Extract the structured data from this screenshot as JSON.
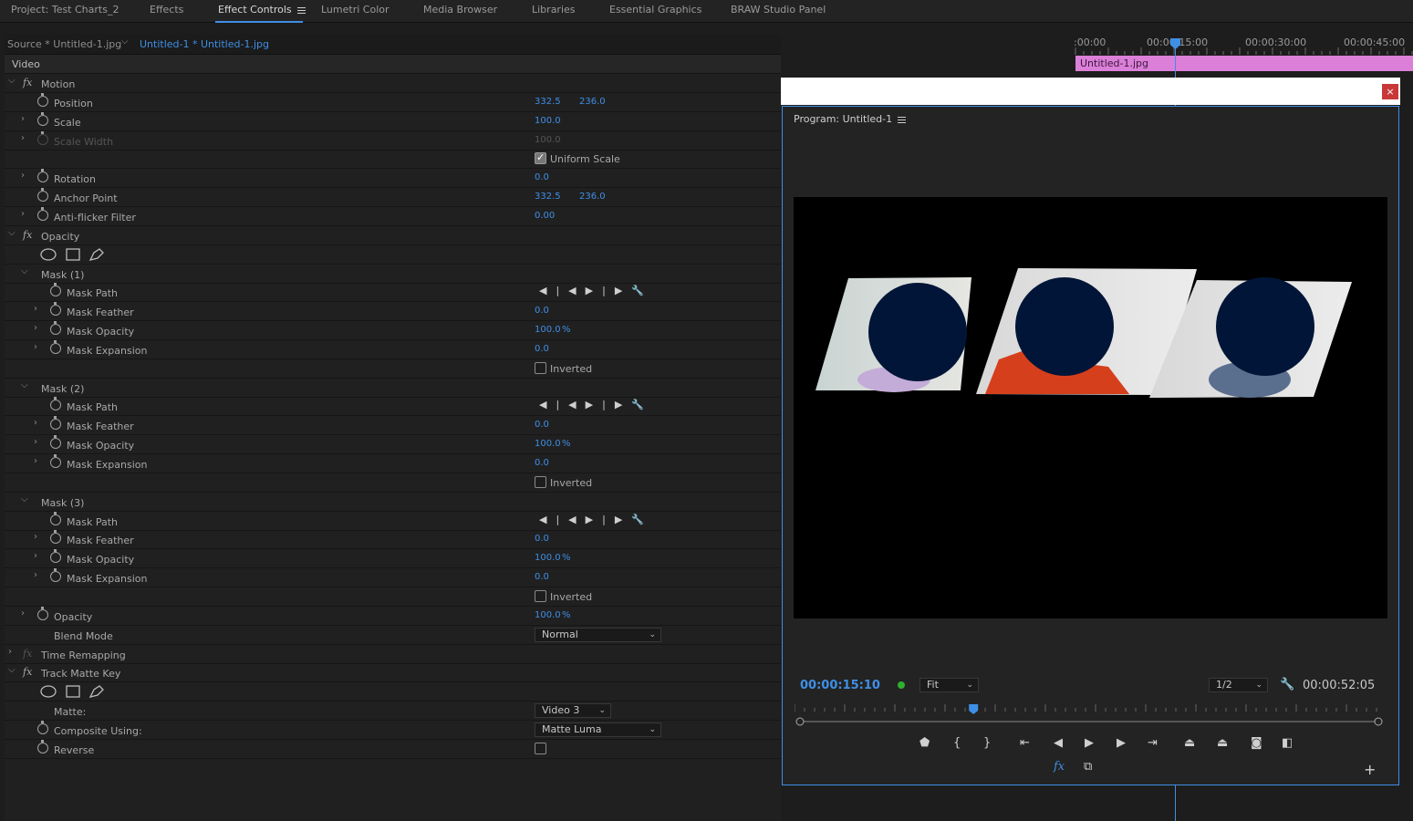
{
  "tabs": [
    {
      "label": "Project: Test Charts_2",
      "active": false
    },
    {
      "label": "Effects",
      "active": false
    },
    {
      "label": "Effect Controls",
      "active": true
    },
    {
      "label": "Lumetri Color",
      "active": false
    },
    {
      "label": "Media Browser",
      "active": false
    },
    {
      "label": "Libraries",
      "active": false
    },
    {
      "label": "Essential Graphics",
      "active": false
    },
    {
      "label": "BRAW Studio Panel",
      "active": false
    }
  ],
  "effect_controls": {
    "source_label": "Source * Untitled-1.jpg",
    "clip_label": "Untitled-1 * Untitled-1.jpg",
    "section": "Video",
    "rows": [
      {
        "kind": "effect",
        "label": "Motion"
      },
      {
        "kind": "param",
        "label": "Position",
        "v1": "332.5",
        "v2": "236.0"
      },
      {
        "kind": "param",
        "label": "Scale",
        "v1": "100.0",
        "expand": true
      },
      {
        "kind": "param",
        "label": "Scale Width",
        "v1": "100.0",
        "expand": true,
        "dim": true
      },
      {
        "kind": "check",
        "label": "Uniform Scale",
        "checked": true
      },
      {
        "kind": "param",
        "label": "Rotation",
        "v1": "0.0",
        "expand": true
      },
      {
        "kind": "param",
        "label": "Anchor Point",
        "v1": "332.5",
        "v2": "236.0"
      },
      {
        "kind": "param",
        "label": "Anti-flicker Filter",
        "v1": "0.00",
        "expand": true
      },
      {
        "kind": "effect",
        "label": "Opacity"
      },
      {
        "kind": "shapes"
      },
      {
        "kind": "mask",
        "label": "Mask (1)"
      },
      {
        "kind": "maskpath",
        "label": "Mask Path"
      },
      {
        "kind": "subparam",
        "label": "Mask Feather",
        "v1": "0.0"
      },
      {
        "kind": "subparam",
        "label": "Mask Opacity",
        "v1": "100.0",
        "pct": "%"
      },
      {
        "kind": "subparam",
        "label": "Mask Expansion",
        "v1": "0.0"
      },
      {
        "kind": "check",
        "label": "Inverted",
        "checked": false
      },
      {
        "kind": "mask",
        "label": "Mask (2)"
      },
      {
        "kind": "maskpath",
        "label": "Mask Path"
      },
      {
        "kind": "subparam",
        "label": "Mask Feather",
        "v1": "0.0"
      },
      {
        "kind": "subparam",
        "label": "Mask Opacity",
        "v1": "100.0",
        "pct": "%"
      },
      {
        "kind": "subparam",
        "label": "Mask Expansion",
        "v1": "0.0"
      },
      {
        "kind": "check",
        "label": "Inverted",
        "checked": false
      },
      {
        "kind": "mask",
        "label": "Mask (3)"
      },
      {
        "kind": "maskpath",
        "label": "Mask Path"
      },
      {
        "kind": "subparam",
        "label": "Mask Feather",
        "v1": "0.0"
      },
      {
        "kind": "subparam",
        "label": "Mask Opacity",
        "v1": "100.0",
        "pct": "%"
      },
      {
        "kind": "subparam",
        "label": "Mask Expansion",
        "v1": "0.0"
      },
      {
        "kind": "check",
        "label": "Inverted",
        "checked": false
      },
      {
        "kind": "param",
        "label": "Opacity",
        "v1": "100.0",
        "pct": "%",
        "expand": true
      },
      {
        "kind": "dropdown",
        "label": "Blend Mode",
        "value": "Normal",
        "nostop": true,
        "wide": true
      },
      {
        "kind": "effect",
        "label": "Time Remapping",
        "expand": true,
        "fxdim": true
      },
      {
        "kind": "effect",
        "label": "Track Matte Key"
      },
      {
        "kind": "shapes"
      },
      {
        "kind": "dropdown",
        "label": "Matte:",
        "value": "Video 3",
        "nostop": true,
        "wide": false
      },
      {
        "kind": "dropdown",
        "label": "Composite Using:",
        "value": "Matte Luma",
        "wide": true
      },
      {
        "kind": "checkparam",
        "label": "Reverse",
        "checked": false
      }
    ]
  },
  "timeline": {
    "timecodes": [
      ":00:00",
      "00:00:15:00",
      "00:00:30:00",
      "00:00:45:00"
    ],
    "clip_name": "Untitled-1.jpg"
  },
  "program_monitor": {
    "title": "Program: Untitled-1",
    "current_time": "00:00:15:10",
    "zoom": "Fit",
    "resolution": "1/2",
    "duration": "00:00:52:05",
    "playhead_fraction": 0.3,
    "close_label": "×"
  },
  "colors": {
    "accent": "#3f8fe6",
    "clip": "#db7fd9",
    "mask_fill": "#001537"
  }
}
